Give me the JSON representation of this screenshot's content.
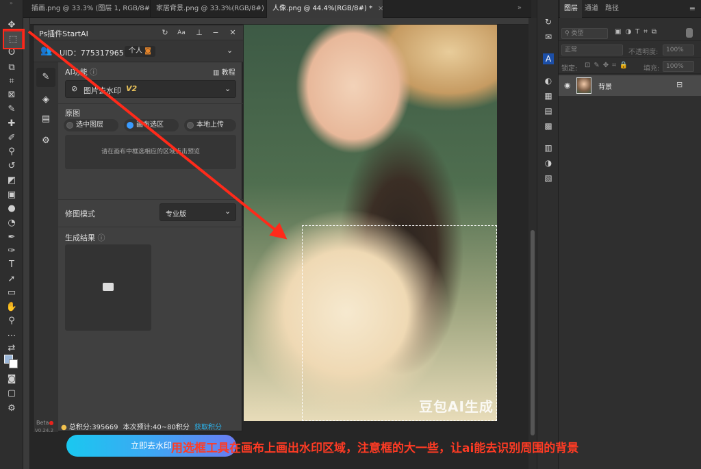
{
  "tabs": [
    {
      "label": "插画.png @ 33.3% (图层 1, RGB/8#) *"
    },
    {
      "label": "家居背景.png @ 33.3%(RGB/8#) *"
    },
    {
      "label": "人像.png @ 44.4%(RGB/8#) *"
    }
  ],
  "tab_close": "×",
  "layers_panel": {
    "tabs": [
      "图层",
      "通道",
      "路径"
    ],
    "kind_filter": "类型",
    "blend_mode": "正常",
    "opacity_label": "不透明度:",
    "opacity_value": "100%",
    "lock_label": "锁定:",
    "fill_label": "填充:",
    "fill_value": "100%",
    "layer_name": "背景"
  },
  "plugin": {
    "title": "Ps插件StartAI",
    "uid_text": "UID：775317965",
    "account_type": "个人",
    "section_ai": "AI功能",
    "tutorial": "教程",
    "feature_name": "图片去水印",
    "feature_version": "V2",
    "section_source": "原图",
    "source_options": [
      "选中图层",
      "画布选区",
      "本地上传"
    ],
    "hint": "请在画布中框选相应的区域点击预览",
    "mode_label": "修图模式",
    "mode_value": "专业版",
    "result_label": "生成结果",
    "points_text": "总积分:395669",
    "estimate_text": "本次预计:40~80积分",
    "get_points": "获取积分",
    "run_button": "立即去水印",
    "beta": "Beta",
    "version": "V0.24.2"
  },
  "canvas": {
    "watermark": "豆包AI生成"
  },
  "caption": "用选框工具在画布上画出水印区域，注意框的大一些，让ai能去识别周围的背景",
  "colors": {
    "annotation_red": "#ff2a1a",
    "button_gradient_start": "#1ac8f0",
    "button_gradient_end": "#6a7cf2",
    "accent_blue": "#3a9bff"
  }
}
